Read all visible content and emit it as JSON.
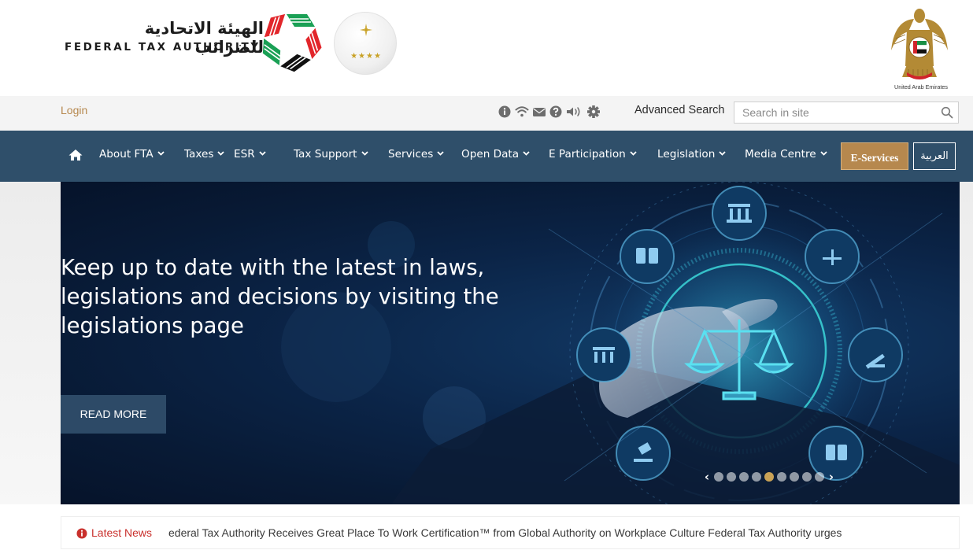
{
  "header": {
    "fta_name_ar": "الهيئة الاتحادية للضرائب",
    "fta_name_en": "FEDERAL TAX AUTHORITY",
    "uae_label": "United Arab Emirates",
    "award_stars": "★★★★"
  },
  "utility": {
    "login": "Login",
    "icons": [
      "info-icon",
      "wifi-icon",
      "envelope-icon",
      "question-icon",
      "volume-icon",
      "gear-icon"
    ],
    "advanced_search": "Advanced Search",
    "search_placeholder": "Search in site"
  },
  "nav": {
    "items": [
      {
        "label": "About FTA"
      },
      {
        "label": "Taxes"
      },
      {
        "label": "ESR"
      },
      {
        "label": "Tax Support"
      },
      {
        "label": "Services"
      },
      {
        "label": "Open Data"
      },
      {
        "label": "E Participation"
      },
      {
        "label": "Legislation"
      },
      {
        "label": "Media Centre"
      }
    ],
    "eservices": "E-Services",
    "arabic": "العربية"
  },
  "hero": {
    "title": "Keep up to date with the latest in laws, legislations and decisions by visiting the legislations page",
    "read_more": "READ MORE",
    "slide_count": 9,
    "active_slide": 5
  },
  "news": {
    "label": "Latest News",
    "text": "ederal Tax Authority Receives Great Place To Work Certification™ from Global Authority on Workplace Culture   Federal Tax Authority urges"
  },
  "colors": {
    "nav_bg": "#2f4f6a",
    "accent_gold": "#b6884e",
    "news_red": "#c9302c"
  }
}
